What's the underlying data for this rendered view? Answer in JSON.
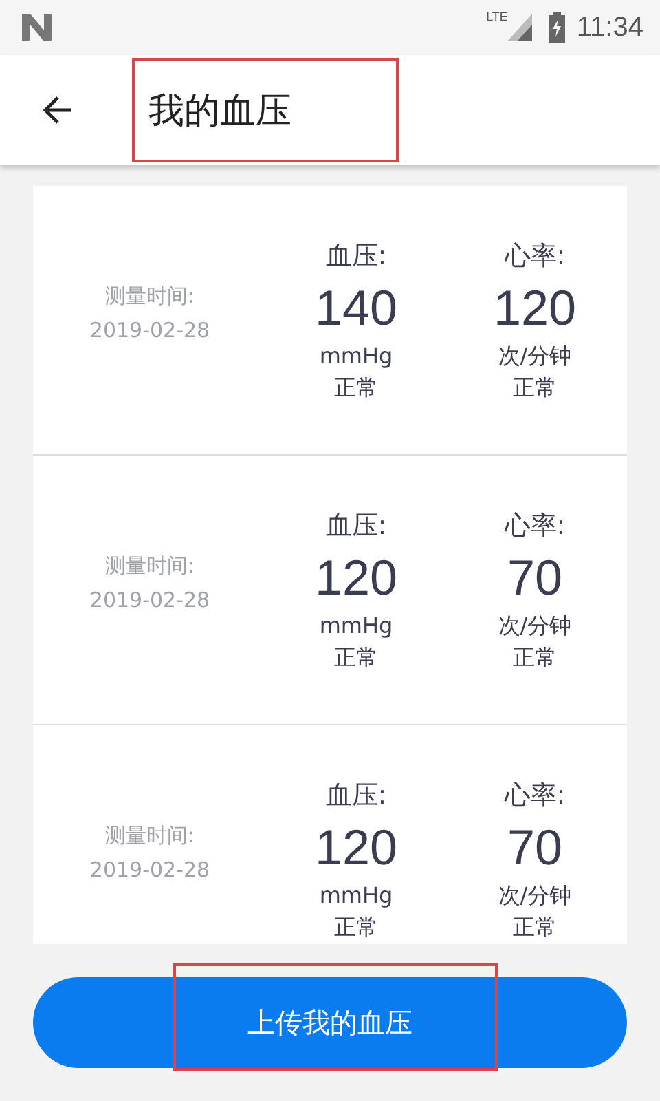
{
  "status_bar": {
    "time": "11:34",
    "network": "LTE"
  },
  "app_bar": {
    "title": "我的血压",
    "highlighted": true
  },
  "records": [
    {
      "time_label": "测量时间:",
      "date": "2019-02-28",
      "bp_label": "血压:",
      "bp_value": "140",
      "bp_unit": "mmHg",
      "bp_status": "正常",
      "hr_label": "心率:",
      "hr_value": "120",
      "hr_unit": "次/分钟",
      "hr_status": "正常"
    },
    {
      "time_label": "测量时间:",
      "date": "2019-02-28",
      "bp_label": "血压:",
      "bp_value": "120",
      "bp_unit": "mmHg",
      "bp_status": "正常",
      "hr_label": "心率:",
      "hr_value": "70",
      "hr_unit": "次/分钟",
      "hr_status": "正常"
    },
    {
      "time_label": "测量时间:",
      "date": "2019-02-28",
      "bp_label": "血压:",
      "bp_value": "120",
      "bp_unit": "mmHg",
      "bp_status": "正常",
      "hr_label": "心率:",
      "hr_value": "70",
      "hr_unit": "次/分钟",
      "hr_status": "正常"
    }
  ],
  "upload_button": {
    "label": "上传我的血压",
    "highlighted": true
  }
}
